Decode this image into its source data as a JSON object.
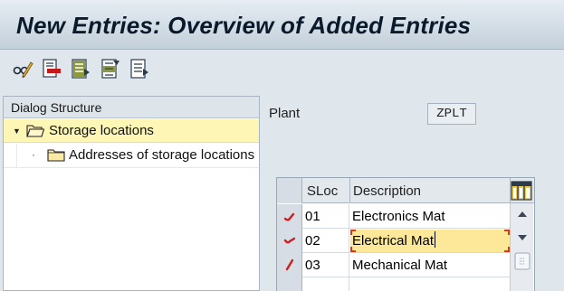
{
  "window": {
    "title": "New Entries: Overview of Added Entries"
  },
  "toolbar": {
    "buttons": [
      {
        "icon": "edit-glasses-pencil-icon"
      },
      {
        "icon": "delete-entry-icon"
      },
      {
        "icon": "select-all-icon"
      },
      {
        "icon": "select-block-icon"
      },
      {
        "icon": "deselect-all-icon"
      }
    ]
  },
  "dialog_structure": {
    "header": "Dialog Structure",
    "nodes": [
      {
        "label": "Storage locations",
        "expanded": true,
        "selected": true,
        "icon": "open-folder-icon"
      },
      {
        "label": "Addresses of storage locations",
        "expanded": false,
        "selected": false,
        "icon": "folder-icon"
      }
    ]
  },
  "plant": {
    "label": "Plant",
    "value": "ZPLT"
  },
  "table": {
    "columns": [
      "SLoc",
      "Description"
    ],
    "rows": [
      {
        "sloc": "01",
        "description": "Electronics Mat",
        "active": false
      },
      {
        "sloc": "02",
        "description": "Electrical Mat",
        "active": true
      },
      {
        "sloc": "03",
        "description": "Mechanical Mat",
        "active": false
      },
      {
        "sloc": "",
        "description": "",
        "active": false
      }
    ],
    "column_config_icon": "table-settings-icon"
  },
  "colors": {
    "title_bg": "#d3dde6",
    "tree_selected": "#fdf6b5",
    "active_cell": "#fde89a",
    "row_mark": "#cc1f1f"
  }
}
